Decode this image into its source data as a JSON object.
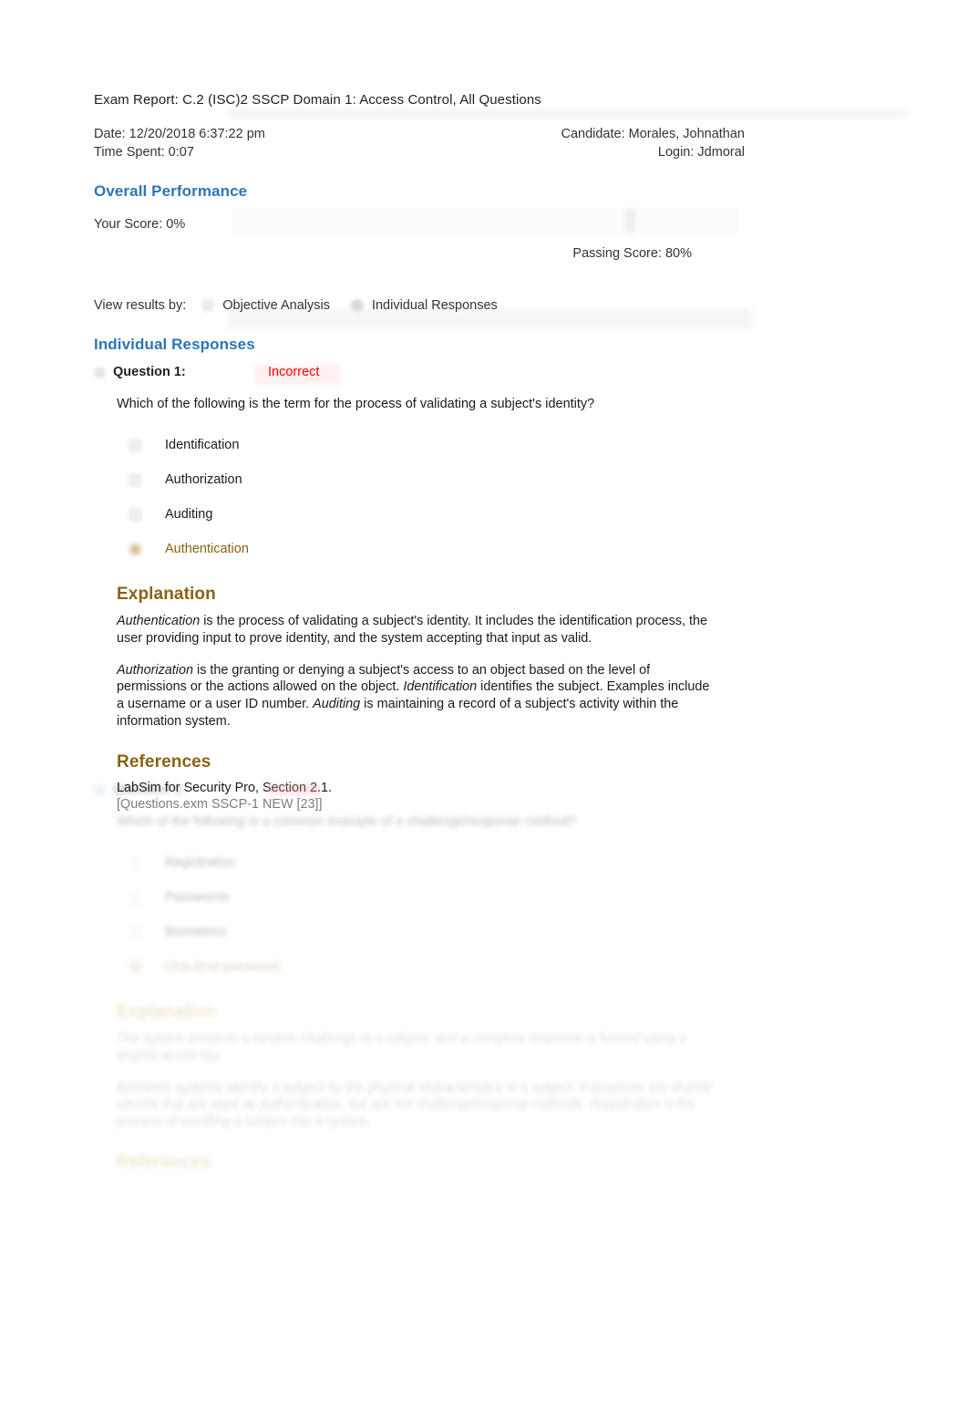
{
  "report": {
    "title": "Exam Report: C.2 (ISC)2 SSCP Domain 1: Access Control, All Questions",
    "date_label": "Date: 12/20/2018 6:37:22 pm",
    "time_spent_label": "Time Spent: 0:07",
    "candidate_label": "Candidate: Morales, Johnathan",
    "login_label": "Login: Jdmoral"
  },
  "overall": {
    "heading": "Overall Performance",
    "your_score_label": "Your Score:  0%",
    "passing_score_label": "Passing Score:  80%",
    "score_percent": 0,
    "passing_percent": 80
  },
  "view_results": {
    "label": "View results by:",
    "options": [
      {
        "label": "Objective Analysis",
        "selected": false
      },
      {
        "label": "Individual Responses",
        "selected": true
      }
    ]
  },
  "individual_responses": {
    "heading": "Individual Responses",
    "questions": [
      {
        "number_label": "Question 1:",
        "status": "Incorrect",
        "status_color": "#FF0000",
        "text": "Which of the following is the term for the process of validating a subject's identity?",
        "options": [
          {
            "label": "Identification",
            "correct": false
          },
          {
            "label": "Authorization",
            "correct": false
          },
          {
            "label": "Auditing",
            "correct": false
          },
          {
            "label": "Authentication",
            "correct": true
          }
        ],
        "explanation": {
          "heading": "Explanation",
          "paragraph_1": {
            "lead": "Authentication",
            "rest": " is the process of validating a subject's identity. It includes the identification process, the user providing input to prove identity, and the system accepting that input as valid."
          },
          "paragraph_2": {
            "part_a_lead": "Authorization",
            "part_a_rest": " is the granting or denying a subject's access to an object based on the level of permissions or the actions allowed on the object. ",
            "part_b_lead": "Identification",
            "part_b_rest": " identifies the subject. Examples include a username or a user ID number. ",
            "part_c_lead": "Auditing",
            "part_c_rest": " is maintaining a record of a subject's activity within the information system."
          }
        },
        "references": {
          "heading": "References",
          "line": "LabSim for Security Pro, Section 2.1.",
          "code": "[Questions.exm SSCP-1 NEW [23]]"
        }
      },
      {
        "number_label": "Question 2:",
        "status": "Incorrect",
        "status_color": "#FF0000",
        "text": "Which of the following is a common example of a challenge/response method?",
        "options": [
          {
            "label": "Registration",
            "correct": false
          },
          {
            "label": "Passwords",
            "correct": false
          },
          {
            "label": "Biometrics",
            "correct": false
          },
          {
            "label": "One-time password",
            "correct": true
          }
        ],
        "explanation": {
          "heading": "Explanation",
          "paragraph_1": {
            "lead": "",
            "rest": "The system presents a random challenge to a subject, and a complete response is formed using a shared secret key."
          },
          "paragraph_2": {
            "part_a_lead": "",
            "part_a_rest": "Biometric systems identify a subject by the physical characteristics of a subject. Passwords are shared secrets that are used as authentication, but are not challenge/response methods. Registration is the process of enrolling a subject into a system.",
            "part_b_lead": "",
            "part_b_rest": "",
            "part_c_lead": "",
            "part_c_rest": ""
          }
        },
        "references": {
          "heading": "References",
          "line": "",
          "code": ""
        }
      }
    ]
  },
  "colors": {
    "heading_blue": "#2E75B6",
    "heading_gold": "#8A6212",
    "status_red": "#FF0000",
    "correct_gold": "#8A6212",
    "body_text": "#1A1A1A"
  }
}
